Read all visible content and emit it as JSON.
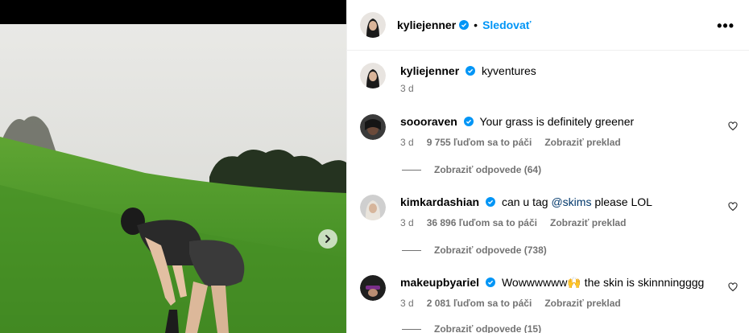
{
  "header": {
    "username": "kyliejenner",
    "separator": "•",
    "follow_label": "Sledovať",
    "more_label": "•••"
  },
  "caption": {
    "username": "kyliejenner",
    "text": "kyventures",
    "time": "3 d"
  },
  "comments": [
    {
      "username": "soooraven",
      "text": "Your grass is definitely greener",
      "time": "3 d",
      "likes": "9 755 ľuďom sa to páči",
      "translate": "Zobraziť preklad",
      "replies": "Zobraziť odpovede (64)"
    },
    {
      "username": "kimkardashian",
      "text_before": "can u tag ",
      "mention": "@skims",
      "text_after": " please LOL",
      "time": "3 d",
      "likes": "36 896 ľuďom sa to páči",
      "translate": "Zobraziť preklad",
      "replies": "Zobraziť odpovede (738)"
    },
    {
      "username": "makeupbyariel",
      "text": "Wowwwwww🙌 the skin is skinnningggg",
      "time": "3 d",
      "likes": "2 081 ľuďom sa to páči",
      "translate": "Zobraziť preklad",
      "replies": "Zobraziť odpovede (15)"
    }
  ],
  "icons": {
    "verified": "verified-badge-icon",
    "heart": "heart-outline-icon",
    "next": "chevron-right-icon",
    "more": "more-horizontal-icon"
  },
  "colors": {
    "accent": "#0095f6",
    "verified": "#0095f6",
    "muted": "#737373",
    "mention": "#00376b",
    "grass": "#4e9a2a"
  }
}
